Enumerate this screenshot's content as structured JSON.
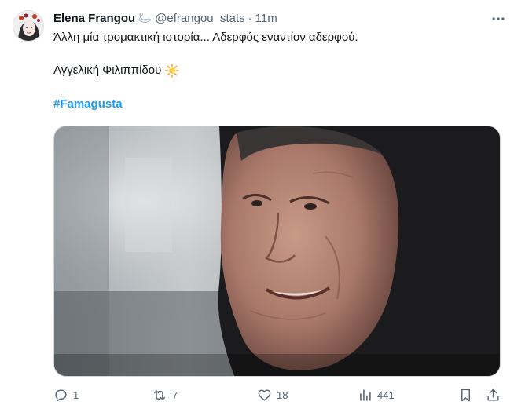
{
  "tweet": {
    "author_name": "Elena Frangou",
    "handle": "@efrangou_stats",
    "separator": "·",
    "time": "11m",
    "text_line_1": "Άλλη μία τρομακτική ιστορία... Αδερφός εναντίον αδερφού.",
    "text_line_2": "Αγγελική Φιλιππίδου",
    "hashtag": "#Famagusta",
    "image_alt": "Photo of an elderly woman wearing a black headscarf, smiling",
    "actions": {
      "replies": "1",
      "reposts": "7",
      "likes": "18",
      "views": "441"
    }
  },
  "colors": {
    "text": "#0f1419",
    "secondary": "#536471",
    "link": "#1d9bf0",
    "border": "#cfd9de"
  },
  "icons": {
    "avatar": "avatar-illustration",
    "name_badge": "swan-icon",
    "emoji": "sun-icon",
    "more": "more-icon",
    "reply": "reply-icon",
    "repost": "repost-icon",
    "like": "heart-icon",
    "views": "views-icon",
    "bookmark": "bookmark-icon",
    "share": "share-icon"
  }
}
